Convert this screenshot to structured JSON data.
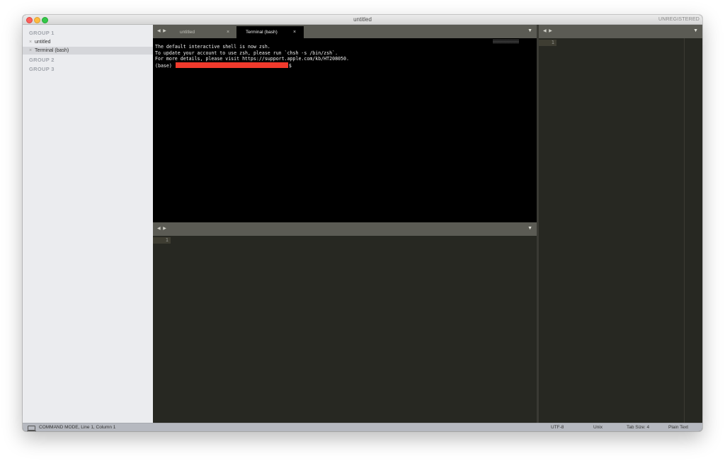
{
  "window": {
    "title": "untitled",
    "registration": "UNREGISTERED"
  },
  "sidebar": {
    "groups": [
      {
        "title": "GROUP 1"
      },
      {
        "title": "GROUP 2"
      },
      {
        "title": "GROUP 3"
      }
    ],
    "files": [
      {
        "close": "×",
        "name": "untitled",
        "selected": false
      },
      {
        "close": "×",
        "name": "Terminal (bash)",
        "selected": true
      }
    ]
  },
  "top_pane": {
    "nav_arrows": "◀ ▶",
    "dropdown": "▼",
    "tabs": [
      {
        "label": "untitled",
        "close": "×",
        "active": false
      },
      {
        "label": "Terminal (bash)",
        "close": "×",
        "active": true
      }
    ]
  },
  "terminal": {
    "lines": [
      "The default interactive shell is now zsh.",
      "To update your account to use zsh, please run `chsh -s /bin/zsh`.",
      "For more details, please visit https://support.apple.com/kb/HT208050."
    ],
    "prompt_prefix": "(base)",
    "prompt_suffix": "$"
  },
  "bottom_pane": {
    "nav_arrows": "◀ ▶",
    "dropdown": "▼",
    "line_number": "1"
  },
  "right_pane": {
    "nav_arrows": "◀ ▶",
    "dropdown": "▼",
    "line_number": "1"
  },
  "statusbar": {
    "mode": "COMMAND MODE, Line 1, Column 1",
    "encoding": "UTF-8",
    "line_endings": "Unix",
    "tab_size": "Tab Size: 4",
    "syntax": "Plain Text"
  },
  "colors": {
    "editor_bg": "#272822",
    "tabbar_bg": "#5b5b54",
    "terminal_bg": "#000000",
    "redaction": "#f03a2c",
    "sidebar_bg": "#ebecef",
    "statusbar_bg": "#b6b9c0"
  }
}
